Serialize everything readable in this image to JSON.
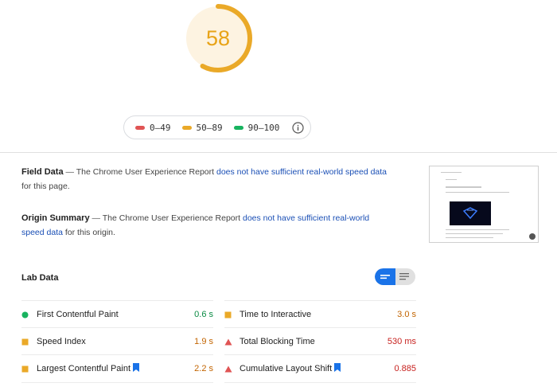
{
  "score": {
    "value": "58",
    "fraction": 0.58,
    "color": "#e8a317"
  },
  "legend": {
    "items": [
      {
        "label": "0–49",
        "color": "#e05454"
      },
      {
        "label": "50–89",
        "color": "#eaa928"
      },
      {
        "label": "90–100",
        "color": "#18b35f"
      }
    ],
    "icon": "info-icon"
  },
  "field_data": {
    "heading": "Field Data",
    "dash": "—",
    "text_before": "The Chrome User Experience Report",
    "link": "does not have sufficient real-world speed data",
    "text_after": "for this page."
  },
  "origin_summary": {
    "heading": "Origin Summary",
    "dash": "—",
    "text_before": "The Chrome User Experience Report",
    "link": "does not have sufficient real-world speed data",
    "text_after": "for this origin."
  },
  "lab_data": {
    "title": "Lab Data",
    "metrics": [
      {
        "name": "First Contentful Paint",
        "value": "0.6 s",
        "status": "good",
        "flag": false
      },
      {
        "name": "Time to Interactive",
        "value": "3.0 s",
        "status": "average",
        "flag": false
      },
      {
        "name": "Speed Index",
        "value": "1.9 s",
        "status": "average",
        "flag": false
      },
      {
        "name": "Total Blocking Time",
        "value": "530 ms",
        "status": "poor",
        "flag": false
      },
      {
        "name": "Largest Contentful Paint",
        "value": "2.2 s",
        "status": "average",
        "flag": true
      },
      {
        "name": "Cumulative Layout Shift",
        "value": "0.885",
        "status": "poor",
        "flag": true
      }
    ]
  },
  "colors": {
    "good": "#18b35f",
    "average": "#eaa928",
    "poor": "#e05454",
    "link": "#1a4fb5",
    "accent": "#1a73e8"
  }
}
